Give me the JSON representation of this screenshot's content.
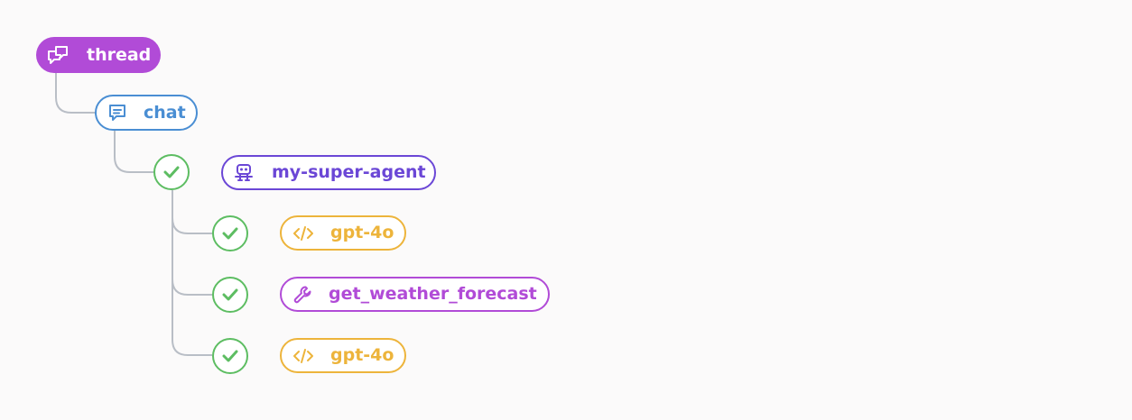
{
  "colors": {
    "background": "#fbfafa",
    "thread": "#b14bd7",
    "chat": "#4a8ed3",
    "agent": "#6b47d6",
    "llm": "#edb43b",
    "tool": "#b14bd7",
    "success": "#5dbd62",
    "connector": "#b9bec6"
  },
  "nodes": {
    "thread": {
      "label": "thread",
      "icon": "chat-bubbles-icon"
    },
    "chat": {
      "label": "chat",
      "icon": "message-icon"
    },
    "agent": {
      "label": "my-super-agent",
      "icon": "robot-icon",
      "status": "success"
    },
    "llm_call_1": {
      "label": "gpt-4o",
      "icon": "code-icon",
      "status": "success"
    },
    "tool_call": {
      "label": "get_weather_forecast",
      "icon": "wrench-icon",
      "status": "success"
    },
    "llm_call_2": {
      "label": "gpt-4o",
      "icon": "code-icon",
      "status": "success"
    }
  }
}
